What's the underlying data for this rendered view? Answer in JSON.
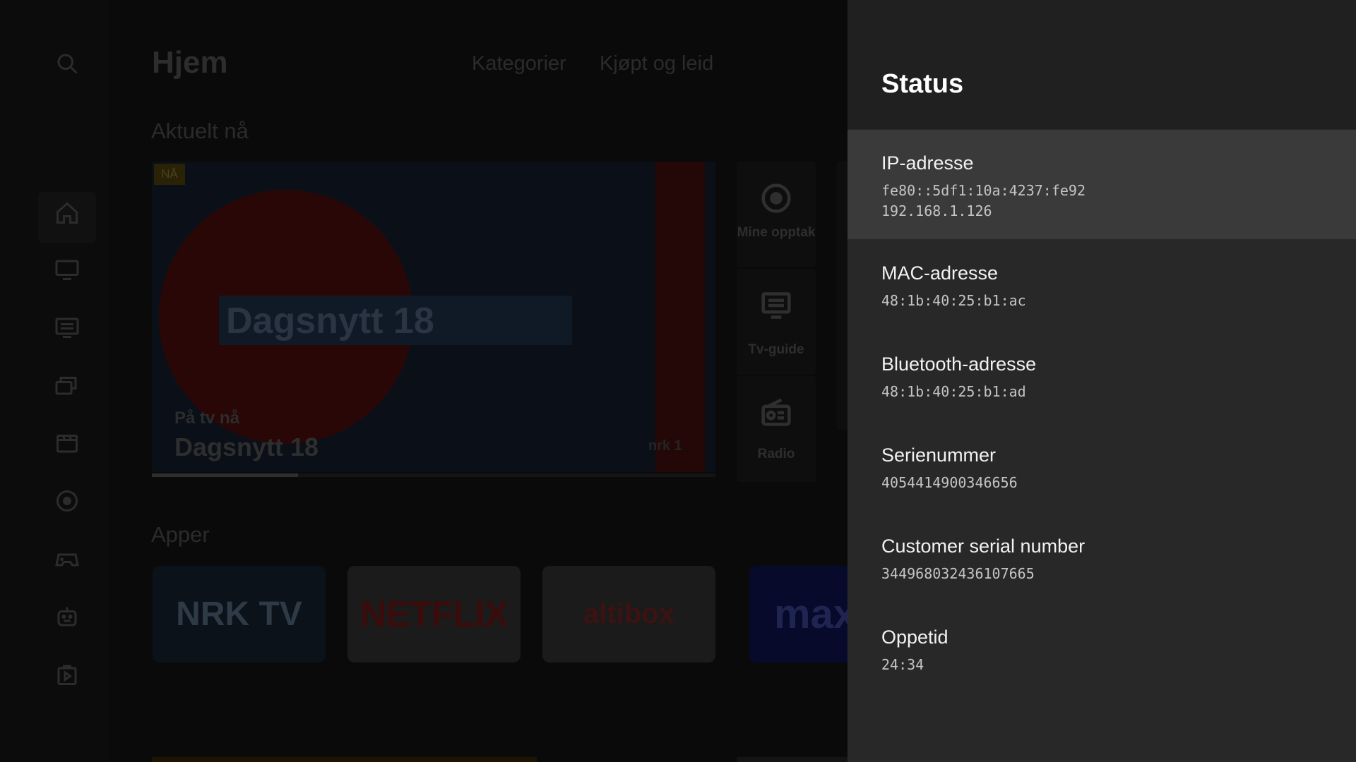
{
  "home": {
    "title": "Hjem",
    "tabs": [
      "Kategorier",
      "Kjøpt og leid"
    ],
    "sections": {
      "now": "Aktuelt nå",
      "apps": "Apper"
    },
    "hero": {
      "badge": "NÅ",
      "banner_text": "Dagsnytt 18",
      "subtitle": "På tv nå",
      "title": "Dagsnytt 18",
      "channel_logo": "nrk 1",
      "progress": 0.26
    },
    "quick_tiles": [
      {
        "label": "Mine opptak",
        "icon": "record-icon"
      },
      {
        "label": "Tv-guide",
        "icon": "tv-guide-icon"
      },
      {
        "label": "Radio",
        "icon": "radio-icon"
      }
    ],
    "apps": [
      "NRK TV",
      "NETFLIX",
      "altibox",
      "max"
    ],
    "side_rail_icons": [
      "search-icon",
      "home-icon",
      "tv-icon",
      "guide-icon",
      "library-icon",
      "movies-icon",
      "recordings-icon",
      "games-icon",
      "kids-icon",
      "play-store-icon"
    ]
  },
  "status_panel": {
    "title": "Status",
    "items": [
      {
        "label": "IP-adresse",
        "values": [
          "fe80::5df1:10a:4237:fe92",
          "192.168.1.126"
        ]
      },
      {
        "label": "MAC-adresse",
        "values": [
          "48:1b:40:25:b1:ac"
        ]
      },
      {
        "label": "Bluetooth-adresse",
        "values": [
          "48:1b:40:25:b1:ad"
        ]
      },
      {
        "label": "Serienummer",
        "values": [
          "4054414900346656"
        ]
      },
      {
        "label": "Customer serial number",
        "values": [
          "344968032436107665"
        ]
      },
      {
        "label": "Oppetid",
        "values": [
          "24:34"
        ]
      }
    ]
  },
  "colors": {
    "panel_bg": "#282828",
    "panel_header_bg": "#202020",
    "focused_row_bg": "#3a3a3a"
  }
}
